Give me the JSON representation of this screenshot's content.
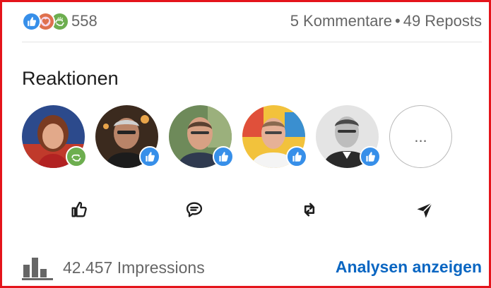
{
  "stats": {
    "reaction_icons": [
      "like-icon",
      "love-icon",
      "support-icon"
    ],
    "reaction_count": "558",
    "comments": "5 Kommentare",
    "separator": "•",
    "reposts": "49 Reposts"
  },
  "reactions": {
    "title": "Reaktionen",
    "people": [
      {
        "reaction": "support-icon"
      },
      {
        "reaction": "like-icon"
      },
      {
        "reaction": "like-icon"
      },
      {
        "reaction": "like-icon"
      },
      {
        "reaction": "like-icon"
      }
    ],
    "more_label": "..."
  },
  "actions": [
    {
      "icon": "thumbs-up-icon"
    },
    {
      "icon": "comment-icon"
    },
    {
      "icon": "repost-icon"
    },
    {
      "icon": "send-icon"
    }
  ],
  "footer": {
    "icon": "bar-chart-icon",
    "impressions": "42.457 Impressions",
    "analytics_link": "Analysen anzeigen"
  },
  "colors": {
    "like": "#378fe9",
    "love": "#df704d",
    "support": "#6dae4f",
    "link": "#0a66c2",
    "frame": "#e4141b"
  }
}
